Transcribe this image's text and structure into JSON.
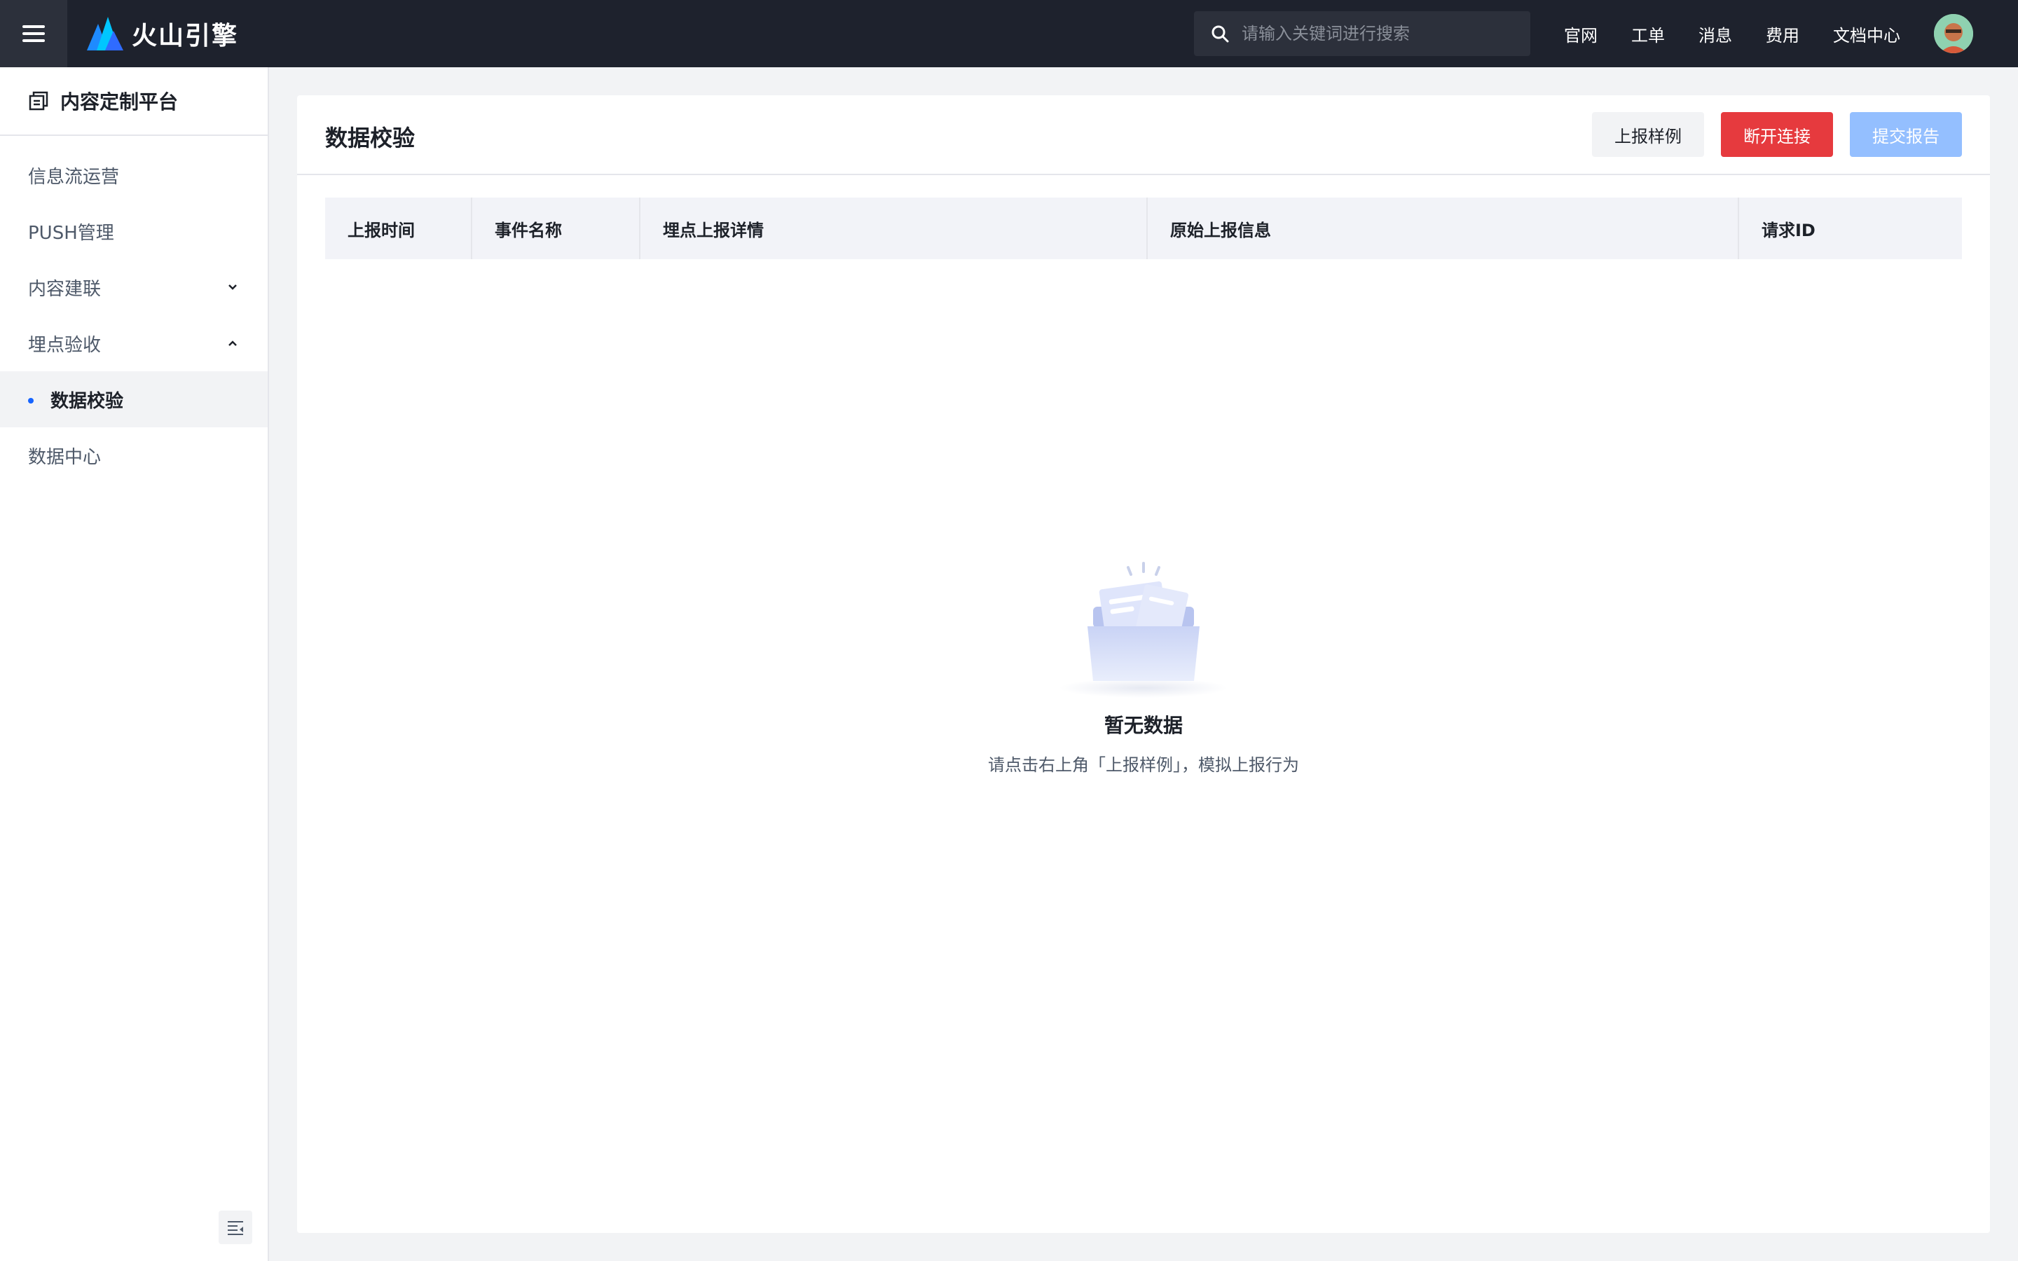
{
  "header": {
    "brand": "火山引擎",
    "search_placeholder": "请输入关键词进行搜索",
    "nav": [
      "官网",
      "工单",
      "消息",
      "费用",
      "文档中心"
    ]
  },
  "sidebar": {
    "title": "内容定制平台",
    "items": [
      {
        "label": "信息流运营"
      },
      {
        "label": "PUSH管理"
      },
      {
        "label": "内容建联"
      },
      {
        "label": "埋点验收"
      },
      {
        "label": "数据校验"
      },
      {
        "label": "数据中心"
      }
    ]
  },
  "main": {
    "title": "数据校验",
    "buttons": {
      "sample": "上报样例",
      "disconnect": "断开连接",
      "submit": "提交报告"
    },
    "columns": [
      "上报时间",
      "事件名称",
      "埋点上报详情",
      "原始上报信息",
      "请求ID"
    ],
    "empty": {
      "title": "暂无数据",
      "desc": "请点击右上角「上报样例」，模拟上报行为"
    }
  },
  "colors": {
    "topbar": "#1e222d",
    "accent": "#1664ff",
    "danger": "#e63a3e",
    "disabled_primary": "#94bfff"
  }
}
